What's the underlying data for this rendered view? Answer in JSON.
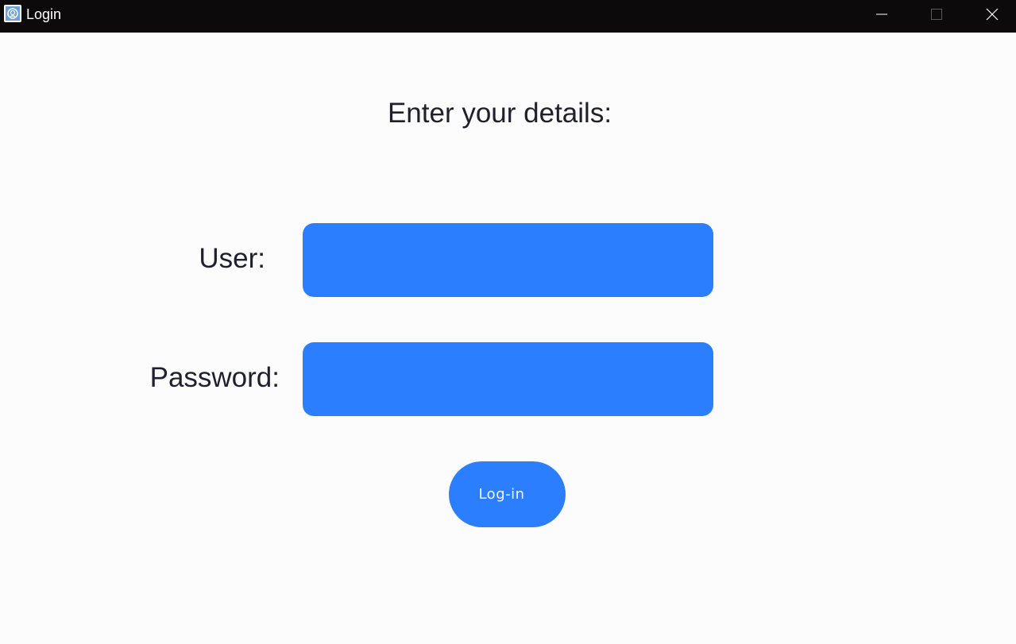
{
  "window": {
    "title": "Login",
    "icon": "app-icon",
    "controls": {
      "minimize_icon": "minimize-icon",
      "maximize_icon": "maximize-icon",
      "close_icon": "close-icon"
    }
  },
  "form": {
    "heading": "Enter your details:",
    "user_label": "User:",
    "user_value": "",
    "password_label": "Password:",
    "password_value": "",
    "submit_label": "Log-in"
  },
  "colors": {
    "titlebar": "#0d0a0b",
    "background": "#fcfcfd",
    "accent": "#2b7fff",
    "text": "#1f1f2e"
  }
}
